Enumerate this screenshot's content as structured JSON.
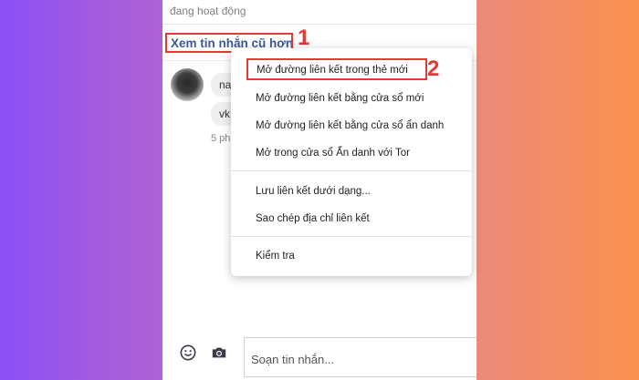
{
  "chat": {
    "status": "đang hoạt động",
    "older_messages_link": "Xem tin nhắn cũ hơn",
    "messages": [
      {
        "text": "na"
      },
      {
        "text": "vk"
      }
    ],
    "time": "5 ph"
  },
  "annotations": {
    "step1": "1",
    "step2": "2"
  },
  "context_menu": {
    "items": [
      {
        "label": "Mở đường liên kết trong thẻ mới"
      },
      {
        "label": "Mở đường liên kết bằng cửa sổ mới"
      },
      {
        "label": "Mở đường liên kết bằng cửa sổ ẩn danh"
      },
      {
        "label": "Mở trong cửa sổ Ẩn danh với Tor"
      },
      {
        "label": "Lưu liên kết dưới dạng..."
      },
      {
        "label": "Sao chép địa chỉ liên kết"
      },
      {
        "label": "Kiểm tra"
      }
    ]
  },
  "composer": {
    "placeholder": "Soạn tin nhắn...",
    "icons": [
      "emoji-icon",
      "camera-icon"
    ]
  },
  "colors": {
    "highlight": "#e53935",
    "link": "#3b5998"
  }
}
